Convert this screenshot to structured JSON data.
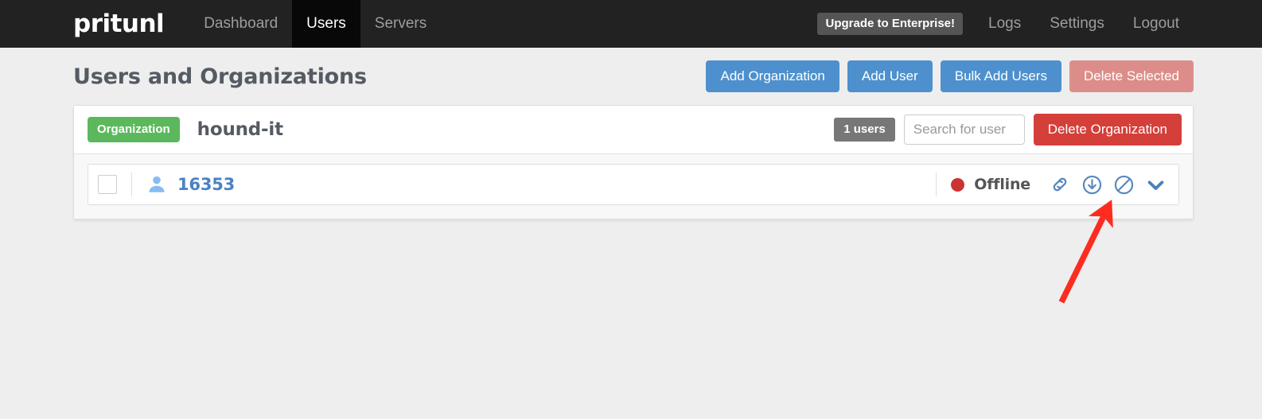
{
  "navbar": {
    "brand": "pritunl",
    "links": [
      {
        "label": "Dashboard",
        "active": false
      },
      {
        "label": "Users",
        "active": true
      },
      {
        "label": "Servers",
        "active": false
      }
    ],
    "upgrade_label": "Upgrade to Enterprise!",
    "right_links": [
      {
        "label": "Logs"
      },
      {
        "label": "Settings"
      },
      {
        "label": "Logout"
      }
    ]
  },
  "page": {
    "title": "Users and Organizations",
    "actions": [
      {
        "label": "Add Organization",
        "style": "primary"
      },
      {
        "label": "Add User",
        "style": "primary"
      },
      {
        "label": "Bulk Add Users",
        "style": "primary"
      },
      {
        "label": "Delete Selected",
        "style": "disabled"
      }
    ]
  },
  "organization": {
    "badge_label": "Organization",
    "name": "hound-it",
    "users_count_label": "1 users",
    "search_placeholder": "Search for user",
    "search_value": "",
    "delete_label": "Delete Organization"
  },
  "user_row": {
    "checkbox_checked": false,
    "avatar_icon": "user-icon",
    "name": "16353",
    "status_text": "Offline",
    "status_color": "#cc3333",
    "icons": [
      {
        "name": "link-icon"
      },
      {
        "name": "download-icon"
      },
      {
        "name": "ban-icon"
      },
      {
        "name": "chevron-down-icon"
      }
    ]
  },
  "annotation": {
    "type": "arrow",
    "color": "#fc2d20",
    "points_at": "download-icon"
  },
  "colors": {
    "navbar_bg": "#222222",
    "active_tab_bg": "#080808",
    "primary": "#4d90cd",
    "danger": "#d43f3a",
    "danger_disabled": "#dd8d89",
    "success": "#5cb85c",
    "page_bg": "#eeeeee",
    "icon_blue": "#5787bd"
  }
}
